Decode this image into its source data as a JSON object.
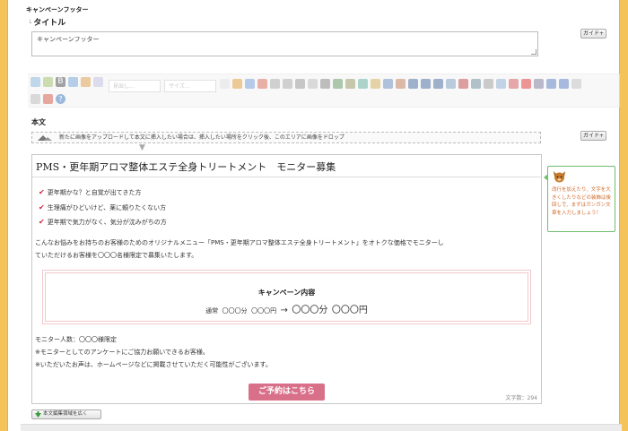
{
  "campaign_footer": {
    "section_title": "キャンペーンフッター",
    "title_label": "タイトル",
    "title_value": "キャンペーンフッター",
    "guide_label": "ガイド+"
  },
  "toolbar": {
    "heading_select": "見出し...",
    "size_select": "サイズ..."
  },
  "body": {
    "label": "本文",
    "guide_label": "ガイド+",
    "dropzone_text": "新たに画像をアップロードして本文に挿入したい場合は、挿入したい場所をクリック後、このエリアに画像をドロップ",
    "title": "PMS・更年期アロマ整体エステ全身トリートメント　モニター募集",
    "checks": [
      "更年期かな？と自覚が出てきた方",
      "生理痛がひどいけど、薬に頼りたくない方",
      "更年期で気力がなく、気分が沈みがちの方"
    ],
    "intro_line1": "こんなお悩みをお持ちのお客様のためのオリジナルメニュー「PMS・更年期アロマ整体エステ全身トリートメント」をオトクな価格でモニターし",
    "intro_line2": "ていただけるお客様を〇〇〇名様限定で募集いたします。",
    "campaign_title": "キャンペーン内容",
    "price_regular_label": "通常",
    "price_regular_time": "〇〇〇分",
    "price_regular_price": "〇〇〇円",
    "price_arrow": "→",
    "price_special_time": "〇〇〇分",
    "price_special_price": "〇〇〇円",
    "note_line1": "モニター人数：〇〇〇様限定",
    "note_line2": "※モニターとしてのアンケートにご協力お願いできるお客様。",
    "note_line3": "※いただいたお声は、ホームページなどに掲載させていただく可能性がございます。",
    "reserve_label": "ご予約はこちら",
    "char_count": "文字数：294"
  },
  "hint": {
    "text": "改行を加えたり、文字を大きくしたりなどの装飾は後回しで、まずはガンガン文章を入力しましょう！"
  },
  "expand_button": "本文編集領域を広く",
  "colors": {
    "accent_border": "#f4c45a",
    "check_red": "#d0253a",
    "reserve_pink": "#d9708a",
    "hint_green": "#6fbf6f"
  }
}
